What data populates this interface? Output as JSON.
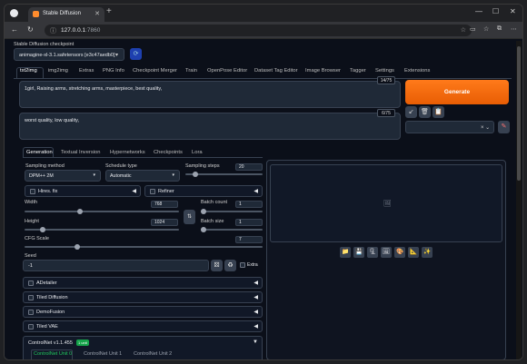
{
  "browser": {
    "tab_title": "Stable Diffusion",
    "url_host": "127.0.0.1",
    "url_port": ":7860"
  },
  "checkpoint": {
    "label": "Stable Diffusion checkpoint",
    "value": "animagine-xl-3.1.safetensors [e3c47aedb0]"
  },
  "main_tabs": [
    "txt2img",
    "img2img",
    "Extras",
    "PNG Info",
    "Checkpoint Merger",
    "Train",
    "OpenPose Editor",
    "Dataset Tag Editor",
    "Image Browser",
    "Tagger",
    "Settings",
    "Extensions"
  ],
  "prompt": {
    "positive": "1girl, Raising arms, stretching arms, masterpiece, best quality,",
    "positive_count": "14/75",
    "negative": "worst quality, low quality,",
    "negative_count": "6/75"
  },
  "generate_label": "Generate",
  "action_icons": [
    "↙",
    "🗑",
    "📋"
  ],
  "styles_caret": "× ⌄",
  "sub_tabs": [
    "Generation",
    "Textual Inversion",
    "Hypernetworks",
    "Checkpoints",
    "Lora"
  ],
  "sampling": {
    "method_label": "Sampling method",
    "method_value": "DPM++ 2M",
    "schedule_label": "Schedule type",
    "schedule_value": "Automatic",
    "steps_label": "Sampling steps",
    "steps_value": "20",
    "steps_level": 0.13
  },
  "hires_label": "Hires. fix",
  "refiner_label": "Refiner",
  "size": {
    "width_label": "Width",
    "width_value": "768",
    "width_level": 0.36,
    "height_label": "Height",
    "height_value": "1024",
    "height_level": 0.12,
    "batch_count_label": "Batch count",
    "batch_count_value": "1",
    "batch_size_label": "Batch size",
    "batch_size_value": "1"
  },
  "cfg": {
    "label": "CFG Scale",
    "value": "7",
    "level": 0.22
  },
  "seed": {
    "label": "Seed",
    "value": "-1",
    "extra_label": "Extra"
  },
  "extensions": [
    "ADetailer",
    "Tiled Diffusion",
    "DemoFusion",
    "Tiled VAE"
  ],
  "controlnet": {
    "title": "ControlNet v1.1.455",
    "badge": "1 unit",
    "units": [
      "ControlNet Unit 0",
      "ControlNet Unit 1",
      "ControlNet Unit 2"
    ]
  },
  "gallery_buttons": [
    "📁",
    "💾",
    "🗜",
    "🖼",
    "🎨",
    "📐",
    "✨"
  ],
  "colors": {
    "accent": "#ff7a1a",
    "background": "#0b0f19",
    "panel": "#1f2937",
    "controlnet_active": "#22c55e"
  }
}
